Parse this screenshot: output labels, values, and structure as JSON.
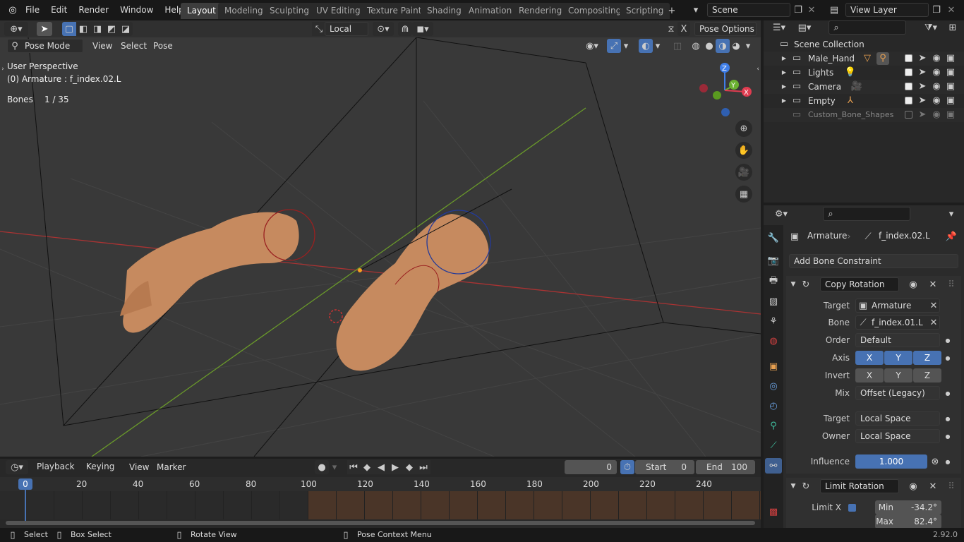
{
  "topbar": {
    "menus": [
      "File",
      "Edit",
      "Render",
      "Window",
      "Help"
    ],
    "workspaces": [
      "Layout",
      "Modeling",
      "Sculpting",
      "UV Editing",
      "Texture Paint",
      "Shading",
      "Animation",
      "Rendering",
      "Compositing",
      "Scripting"
    ],
    "active_workspace": "Layout",
    "scene": "Scene",
    "view_layer": "View Layer"
  },
  "viewport_header": {
    "transform_orientation": "Local",
    "pose_options": "Pose Options",
    "mode": "Pose Mode",
    "menus": [
      "View",
      "Select",
      "Pose"
    ]
  },
  "viewport_overlay": {
    "perspective": "User Perspective",
    "object_info": "(0) Armature : f_index.02.L",
    "bones_label": "Bones",
    "bones_value": "1 / 35"
  },
  "gizmo": {
    "z": "Z",
    "y": "Y",
    "x": "X"
  },
  "outliner": {
    "root": "Scene Collection",
    "items": [
      {
        "name": "Male_Hand",
        "enabled": true
      },
      {
        "name": "Lights",
        "enabled": true
      },
      {
        "name": "Camera",
        "enabled": true
      },
      {
        "name": "Empty",
        "enabled": true
      },
      {
        "name": "Custom_Bone_Shapes",
        "enabled": false
      }
    ]
  },
  "properties": {
    "breadcrumb_object": "Armature",
    "breadcrumb_bone": "f_index.02.L",
    "add_constraint": "Add Bone Constraint",
    "copy_rotation": {
      "name": "Copy Rotation",
      "target_label": "Target",
      "target": "Armature",
      "bone_label": "Bone",
      "bone": "f_index.01.L",
      "order_label": "Order",
      "order": "Default",
      "axis_label": "Axis",
      "invert_label": "Invert",
      "axes": [
        "X",
        "Y",
        "Z"
      ],
      "mix_label": "Mix",
      "mix": "Offset (Legacy)",
      "target_space_label": "Target",
      "target_space": "Local Space",
      "owner_space_label": "Owner",
      "owner_space": "Local Space",
      "influence_label": "Influence",
      "influence": "1.000"
    },
    "limit_rotation": {
      "name": "Limit Rotation",
      "limit_x_label": "Limit X",
      "min_label": "Min",
      "min": "-34.2°",
      "max_label": "Max",
      "max": "82.4°"
    }
  },
  "timeline": {
    "menus": [
      "Playback",
      "Keying",
      "View",
      "Marker"
    ],
    "current_frame": "0",
    "start_label": "Start",
    "start": "0",
    "end_label": "End",
    "end": "100",
    "ruler": [
      "0",
      "20",
      "40",
      "60",
      "80",
      "100",
      "120",
      "140",
      "160",
      "180",
      "200",
      "220",
      "240"
    ],
    "playhead": "0"
  },
  "statusbar": {
    "select": "Select",
    "box_select": "Box Select",
    "rotate_view": "Rotate View",
    "context_menu": "Pose Context Menu",
    "version": "2.92.0"
  }
}
